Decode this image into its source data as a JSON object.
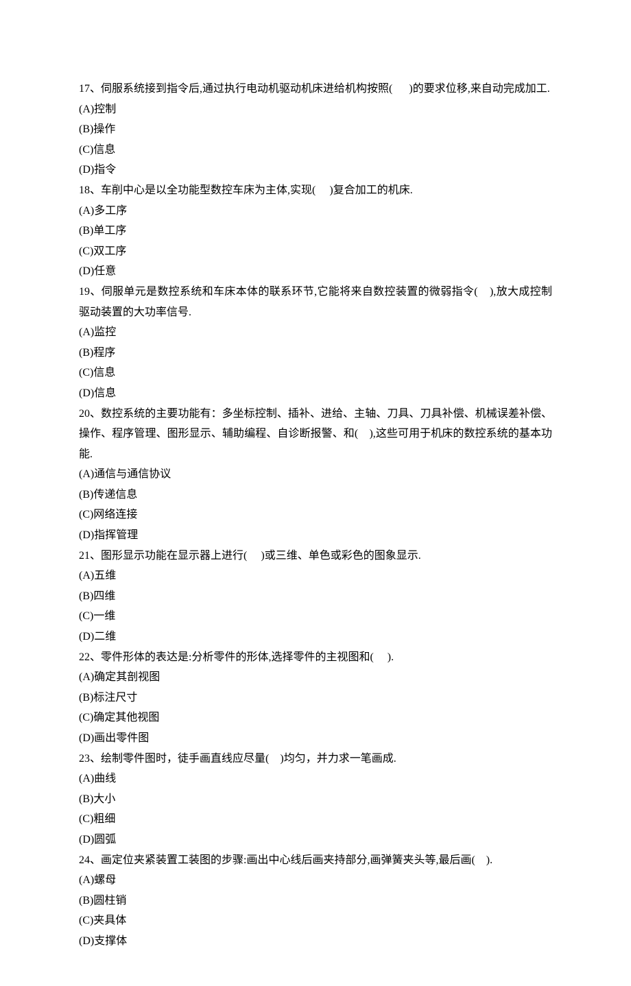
{
  "questions": [
    {
      "number": "17、",
      "text_pre": "伺服系统接到指令后,通过执行电动机驱动机床进给机构按照(",
      "blank": "      ",
      "text_post": ")的要求位移,来自动完成加工.",
      "options": [
        "(A)控制",
        "(B)操作",
        "(C)信息",
        "(D)指令"
      ]
    },
    {
      "number": "18、",
      "text_pre": "车削中心是以全功能型数控车床为主体,实现(",
      "blank": "     ",
      "text_post": ")复合加工的机床.",
      "options": [
        "(A)多工序",
        "(B)单工序",
        "(C)双工序",
        "(D)任意"
      ]
    },
    {
      "number": "19、",
      "text_pre": "伺服单元是数控系统和车床本体的联系环节,它能将来自数控装置的微弱指令(",
      "blank": "    ",
      "text_post": "),放大成控制驱动装置的大功率信号.",
      "options": [
        "(A)监控",
        "(B)程序",
        "(C)信息",
        "(D)信息"
      ]
    },
    {
      "number": "20、",
      "text_pre": "数控系统的主要功能有：多坐标控制、插补、进给、主轴、刀具、刀具补偿、机械误差补偿、操作、程序管理、图形显示、辅助编程、自诊断报警、和(",
      "blank": "    ",
      "text_post": "),这些可用于机床的数控系统的基本功能.",
      "options": [
        "(A)通信与通信协议",
        "(B)传递信息",
        "(C)网络连接",
        "(D)指挥管理"
      ]
    },
    {
      "number": "21、",
      "text_pre": "图形显示功能在显示器上进行(",
      "blank": "     ",
      "text_post": ")或三维、单色或彩色的图象显示.",
      "options": [
        "(A)五维",
        "(B)四维",
        "(C)一维",
        "(D)二维"
      ]
    },
    {
      "number": "22、",
      "text_pre": "零件形体的表达是:分析零件的形体,选择零件的主视图和(",
      "blank": "     ",
      "text_post": ").",
      "options": [
        "(A)确定其剖视图",
        "(B)标注尺寸",
        "(C)确定其他视图",
        "(D)画出零件图"
      ]
    },
    {
      "number": "23、",
      "text_pre": "绘制零件图时，徒手画直线应尽量(",
      "blank": "    ",
      "text_post": ")均匀，并力求一笔画成.",
      "options": [
        "(A)曲线",
        "(B)大小",
        "(C)粗细",
        "(D)圆弧"
      ]
    },
    {
      "number": "24、",
      "text_pre": "画定位夹紧装置工装图的步骤:画出中心线后画夹持部分,画弹簧夹头等,最后画(",
      "blank": "    ",
      "text_post": ").",
      "options": [
        "(A)螺母",
        "(B)圆柱销",
        "(C)夹具体",
        "(D)支撑体"
      ]
    }
  ]
}
